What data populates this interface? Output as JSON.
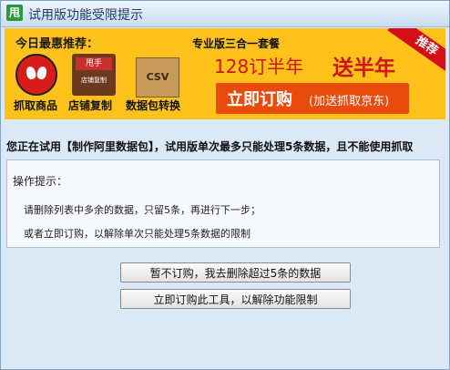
{
  "window": {
    "title": "试用版功能受限提示",
    "app_icon_text": "甩"
  },
  "banner": {
    "heading": "今日最惠推荐：",
    "features": [
      {
        "label": "抓取商品",
        "icon": "spider-icon"
      },
      {
        "label": "店铺复制",
        "icon": "shop-icon",
        "sign": "甩手",
        "sub": "店铺复制"
      },
      {
        "label": "数据包转换",
        "icon": "csv-box-icon",
        "box_text": "CSV"
      }
    ],
    "promo_title": "专业版三合一套餐",
    "promo_price": "128订半年",
    "promo_bonus": "送半年",
    "buy_label": "立即订购",
    "buy_sub": "(加送抓取京东)",
    "ribbon": "推荐",
    "colors": {
      "background": "#ffc21a",
      "accent": "#d2141a",
      "button": "#e84b0c"
    }
  },
  "notice": "您正在试用【制作阿里数据包】，试用版单次最多只能处理5条数据，且不能使用抓取",
  "tips": {
    "title": "操作提示：",
    "line1": "请删除列表中多余的数据，只留5条，再进行下一步；",
    "line2": "或者立即订购，以解除单次只能处理5条数据的限制"
  },
  "buttons": {
    "decline": "暂不订购，我去删除超过5条的数据",
    "purchase": "立即订购此工具，以解除功能限制"
  }
}
